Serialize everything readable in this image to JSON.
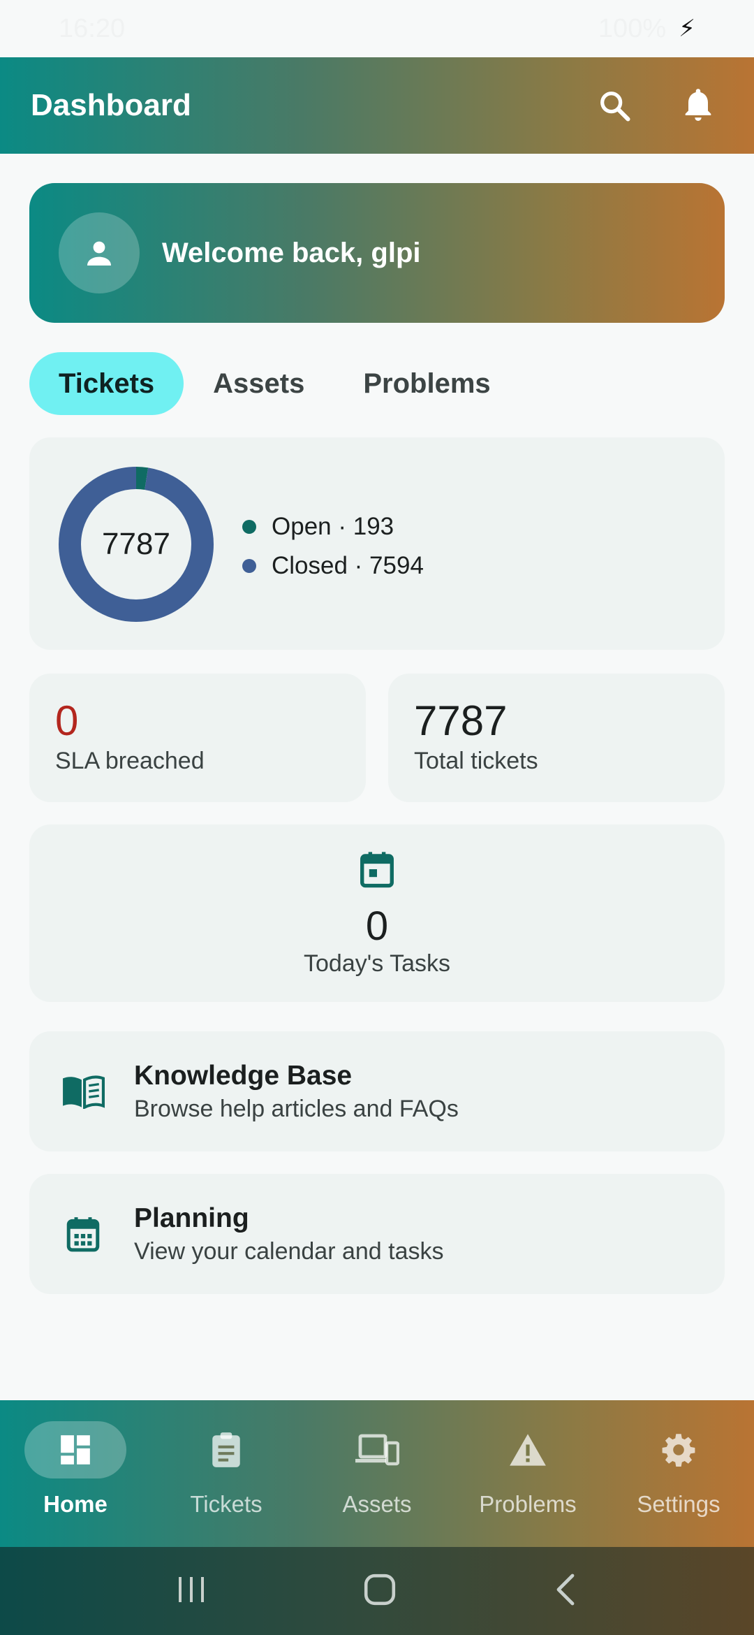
{
  "status_bar": {
    "time": "16:20",
    "battery": "100%"
  },
  "app_bar": {
    "title": "Dashboard",
    "actions": [
      "search-icon",
      "bell-icon"
    ]
  },
  "welcome": {
    "text": "Welcome back, glpi",
    "icon": "person-icon"
  },
  "tabs": [
    {
      "label": "Tickets",
      "active": true
    },
    {
      "label": "Assets",
      "active": false
    },
    {
      "label": "Problems",
      "active": false
    }
  ],
  "chart_data": {
    "type": "pie",
    "center_label": "7787",
    "categories": [
      "Open",
      "Closed"
    ],
    "values": [
      193,
      7594
    ],
    "legend": [
      "Open · 193",
      "Closed · 7594"
    ],
    "colors": [
      "#0f6b63",
      "#3f5f96"
    ]
  },
  "stats": {
    "sla": {
      "value": "0",
      "label": "SLA breached",
      "color": "#b3261e"
    },
    "total": {
      "value": "7787",
      "label": "Total tickets"
    }
  },
  "tasks": {
    "value": "0",
    "label": "Today's Tasks",
    "icon": "calendar-icon"
  },
  "links": [
    {
      "title": "Knowledge Base",
      "subtitle": "Browse help articles and FAQs",
      "icon": "book-icon"
    },
    {
      "title": "Planning",
      "subtitle": "View your calendar and tasks",
      "icon": "calendar-grid-icon"
    }
  ],
  "bottom_nav": [
    {
      "label": "Home",
      "icon": "dashboard-icon",
      "active": true
    },
    {
      "label": "Tickets",
      "icon": "clipboard-icon",
      "active": false
    },
    {
      "label": "Assets",
      "icon": "devices-icon",
      "active": false
    },
    {
      "label": "Problems",
      "icon": "warning-icon",
      "active": false
    },
    {
      "label": "Settings",
      "icon": "gear-icon",
      "active": false
    }
  ],
  "colors": {
    "accent": "#0f6b63",
    "tab_active": "#70f0f2",
    "danger": "#b3261e"
  }
}
